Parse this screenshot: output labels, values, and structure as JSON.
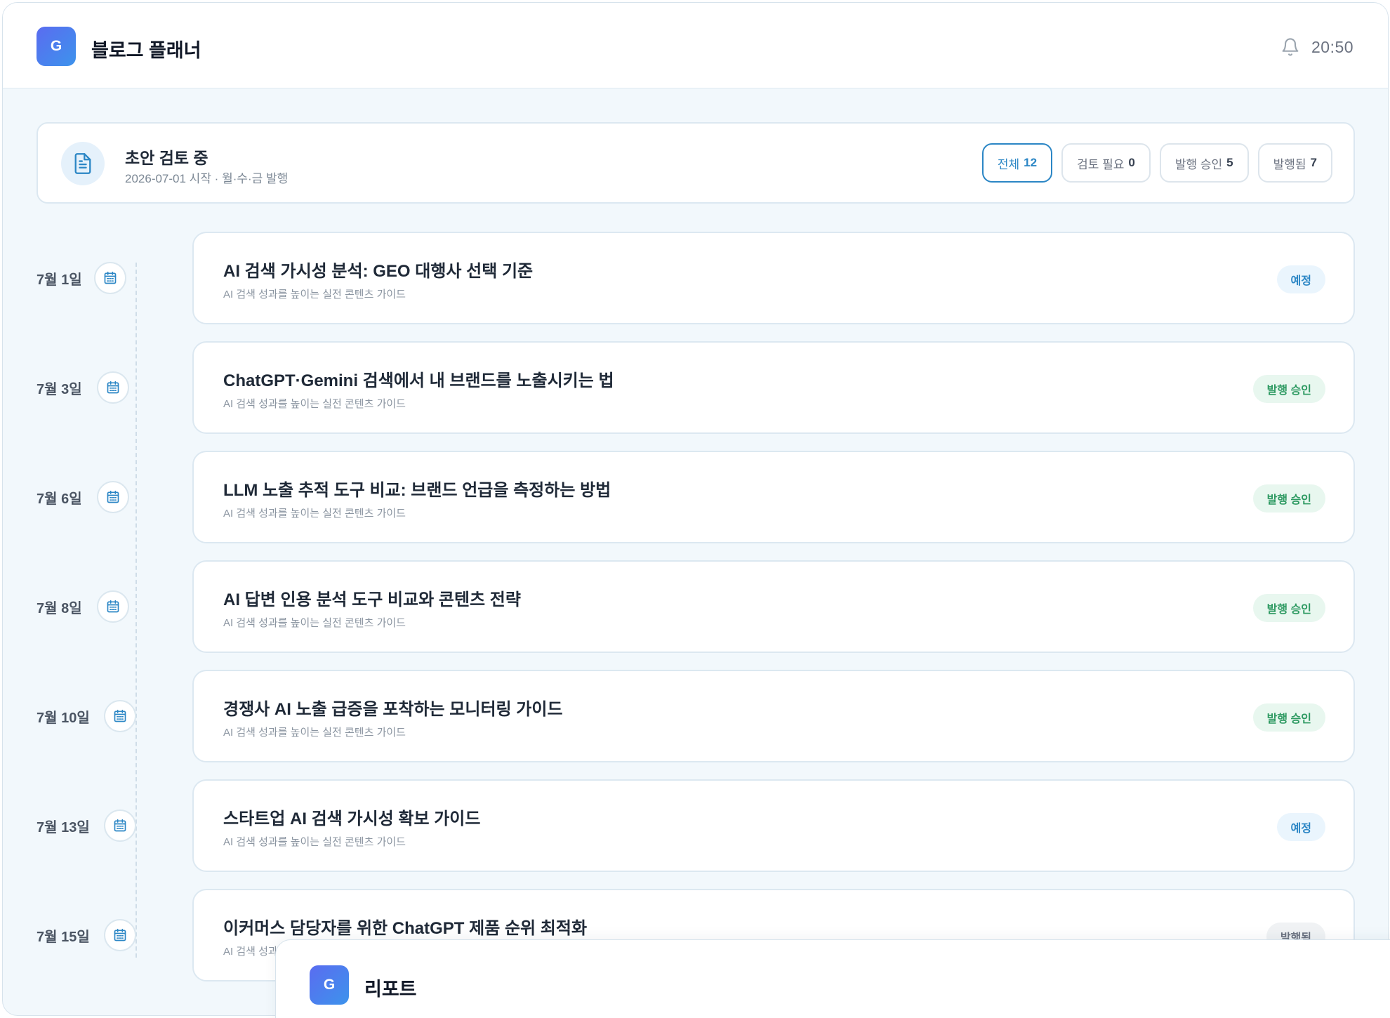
{
  "header": {
    "logo_letter": "G",
    "title": "블로그 플래너",
    "time": "20:50"
  },
  "summary": {
    "title": "초안 검토 중",
    "subtitle": "2026-07-01 시작 · 월·수·금 발행",
    "filters": [
      {
        "label": "전체",
        "count": "12",
        "active": true
      },
      {
        "label": "검토 필요",
        "count": "0",
        "active": false
      },
      {
        "label": "발행 승인",
        "count": "5",
        "active": false
      },
      {
        "label": "발행됨",
        "count": "7",
        "active": false
      }
    ]
  },
  "posts": [
    {
      "date": "7월 1일",
      "title": "AI 검색 가시성 분석: GEO 대행사 선택 기준",
      "subtitle": "AI 검색 성과를 높이는 실전 콘텐츠 가이드",
      "status": "예정",
      "status_color": "blue"
    },
    {
      "date": "7월 3일",
      "title": "ChatGPT·Gemini 검색에서 내 브랜드를 노출시키는 법",
      "subtitle": "AI 검색 성과를 높이는 실전 콘텐츠 가이드",
      "status": "발행 승인",
      "status_color": "green"
    },
    {
      "date": "7월 6일",
      "title": "LLM 노출 추적 도구 비교: 브랜드 언급을 측정하는 방법",
      "subtitle": "AI 검색 성과를 높이는 실전 콘텐츠 가이드",
      "status": "발행 승인",
      "status_color": "green"
    },
    {
      "date": "7월 8일",
      "title": "AI 답변 인용 분석 도구 비교와 콘텐츠 전략",
      "subtitle": "AI 검색 성과를 높이는 실전 콘텐츠 가이드",
      "status": "발행 승인",
      "status_color": "green"
    },
    {
      "date": "7월 10일",
      "title": "경쟁사 AI 노출 급증을 포착하는 모니터링 가이드",
      "subtitle": "AI 검색 성과를 높이는 실전 콘텐츠 가이드",
      "status": "발행 승인",
      "status_color": "green"
    },
    {
      "date": "7월 13일",
      "title": "스타트업 AI 검색 가시성 확보 가이드",
      "subtitle": "AI 검색 성과를 높이는 실전 콘텐츠 가이드",
      "status": "예정",
      "status_color": "blue"
    },
    {
      "date": "7월 15일",
      "title": "이커머스 담당자를 위한 ChatGPT 제품 순위 최적화",
      "subtitle": "AI 검색 성과를 높이는 실전 콘텐츠 가이드",
      "status": "발행됨",
      "status_color": "gray"
    }
  ],
  "popup": {
    "logo_letter": "G",
    "title": "리포트"
  },
  "colors": {
    "accent": "#2b86c5",
    "approved": "#2e9a62",
    "brand_gradient_start": "#5a6cf0",
    "brand_gradient_end": "#3d93ec"
  },
  "icons": {
    "notification": "bell-icon",
    "summary": "document-icon",
    "date": "calendar-icon"
  }
}
